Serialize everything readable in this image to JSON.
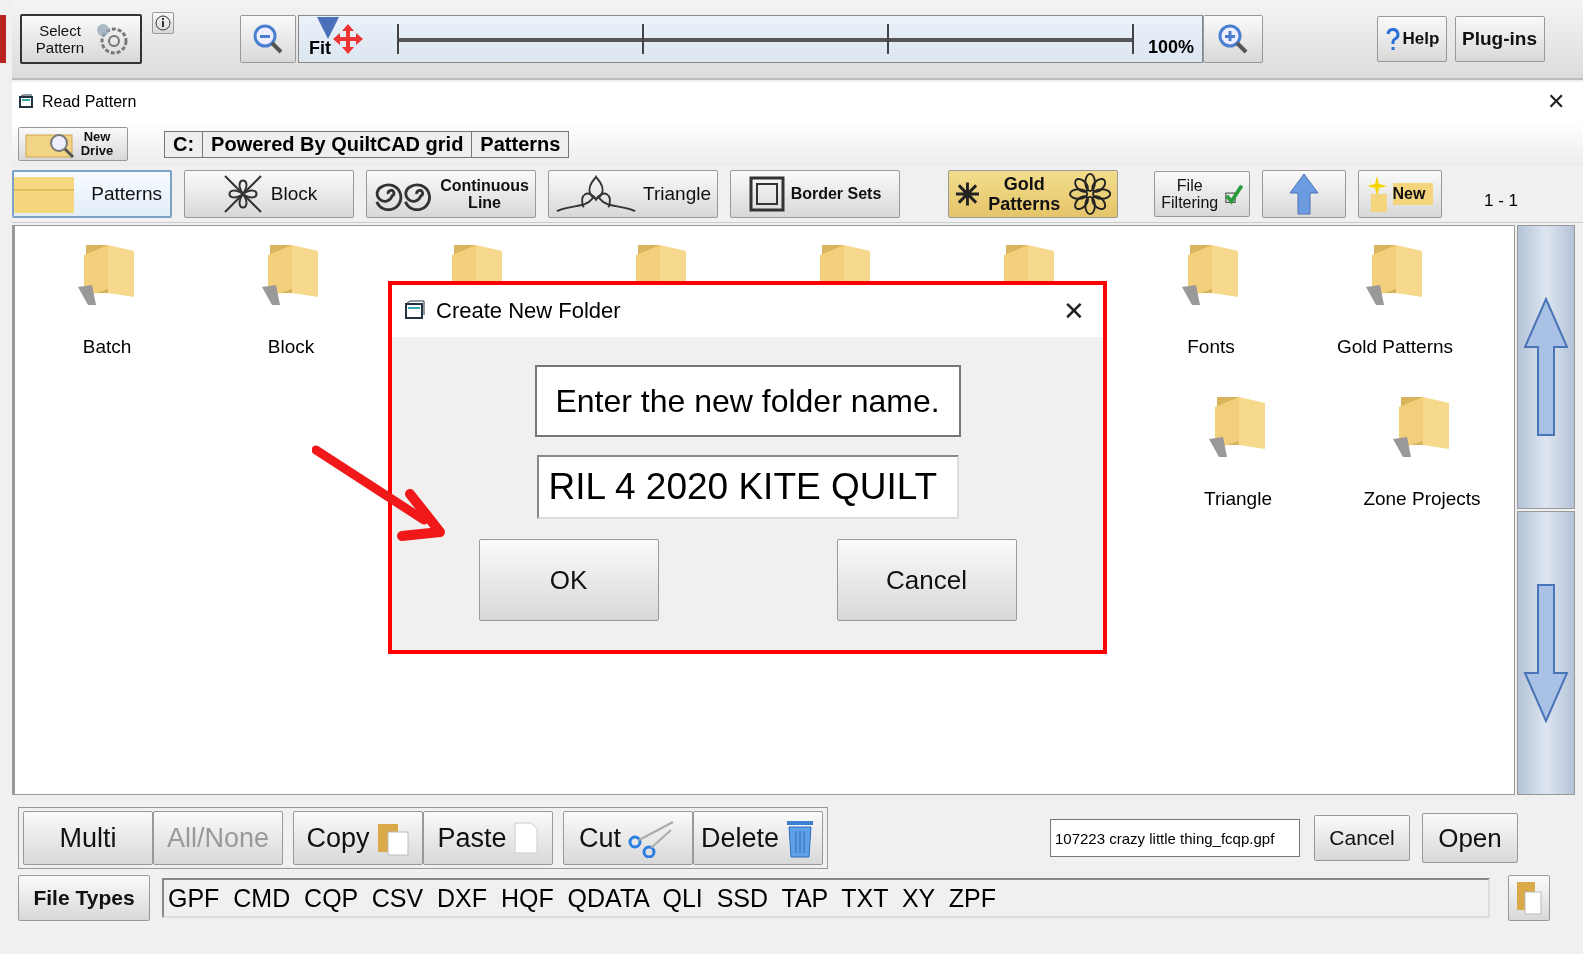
{
  "toolbar": {
    "select_pattern": "Select Pattern",
    "zoom_slider": {
      "fit_label": "Fit",
      "max_label": "100%",
      "level": 0
    },
    "help": "Help",
    "plugins": "Plug-ins"
  },
  "window": {
    "title": "Read Pattern",
    "close": "✕"
  },
  "drive_button": "New Drive",
  "path": [
    "C:",
    "Powered By QuiltCAD grid",
    "Patterns"
  ],
  "categories": [
    {
      "label": "Patterns",
      "kind": "folder",
      "selected": true
    },
    {
      "label": "Block",
      "kind": "block",
      "selected": false
    },
    {
      "label": "Continuous Line",
      "kind": "swirl",
      "selected": false
    },
    {
      "label": "Triangle",
      "kind": "triangle",
      "selected": false
    },
    {
      "label": "Border Sets",
      "kind": "border",
      "selected": false
    },
    {
      "label": "Gold Patterns",
      "kind": "gold",
      "selected": false
    }
  ],
  "file_filtering": "File Filtering",
  "new_folder": "New",
  "page_range": "1 - 1",
  "folder_rows": [
    [
      {
        "label": "Batch"
      },
      {
        "label": "Block"
      },
      {},
      {},
      {},
      {},
      {
        "label": "Fonts"
      },
      {
        "label": "Gold Patterns"
      }
    ],
    [
      {
        "label": "Triangle"
      },
      {
        "label": "Zone Projects"
      }
    ]
  ],
  "dialog": {
    "title": "Create New Folder",
    "close": "✕",
    "message": "Enter the new folder name.",
    "value": "RIL 4 2020 KITE QUILT",
    "buttons": [
      "OK",
      "Cancel"
    ]
  },
  "actions": [
    {
      "label": "Multi",
      "kind": "plain",
      "disabled": false
    },
    {
      "label": "All/None",
      "kind": "plain",
      "disabled": true
    },
    {
      "label": "Copy",
      "kind": "copy",
      "disabled": false
    },
    {
      "label": "Paste",
      "kind": "paste",
      "disabled": false
    },
    {
      "label": "Cut",
      "kind": "cut",
      "disabled": false
    },
    {
      "label": "Delete",
      "kind": "delete",
      "disabled": false
    }
  ],
  "file_name": "107223 crazy little thing_fcqp.gpf",
  "cancel": "Cancel",
  "open": "Open",
  "file_types_button": "File Types",
  "file_types": "GPF  CMD  CQP  CSV  DXF  HQF  QDATA  QLI  SSD  TAP  TXT  XY  ZPF"
}
